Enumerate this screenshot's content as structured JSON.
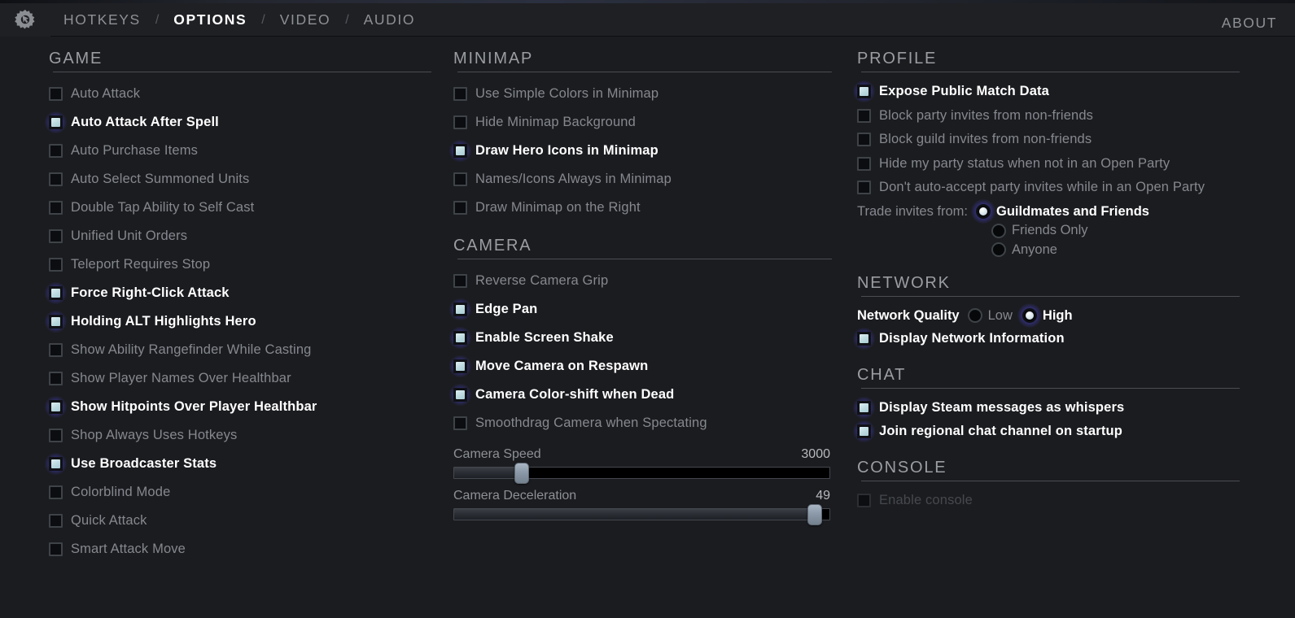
{
  "header": {
    "gear_icon": "gear-cursor-icon",
    "tabs": [
      {
        "label": "HOTKEYS",
        "active": false
      },
      {
        "label": "OPTIONS",
        "active": true
      },
      {
        "label": "VIDEO",
        "active": false
      },
      {
        "label": "AUDIO",
        "active": false
      }
    ],
    "separator": "/",
    "about_label": "ABOUT"
  },
  "game": {
    "title": "GAME",
    "items": [
      {
        "label": "Auto Attack",
        "checked": false
      },
      {
        "label": "Auto Attack After Spell",
        "checked": true
      },
      {
        "label": "Auto Purchase Items",
        "checked": false
      },
      {
        "label": "Auto Select Summoned Units",
        "checked": false
      },
      {
        "label": "Double Tap Ability to Self Cast",
        "checked": false
      },
      {
        "label": "Unified Unit Orders",
        "checked": false
      },
      {
        "label": "Teleport Requires Stop",
        "checked": false
      },
      {
        "label": "Force Right-Click Attack",
        "checked": true
      },
      {
        "label": "Holding ALT Highlights Hero",
        "checked": true
      },
      {
        "label": "Show Ability Rangefinder While Casting",
        "checked": false
      },
      {
        "label": "Show Player Names Over Healthbar",
        "checked": false
      },
      {
        "label": "Show Hitpoints Over Player Healthbar",
        "checked": true
      },
      {
        "label": "Shop Always Uses Hotkeys",
        "checked": false
      },
      {
        "label": "Use Broadcaster Stats",
        "checked": true
      },
      {
        "label": "Colorblind Mode",
        "checked": false
      },
      {
        "label": "Quick Attack",
        "checked": false
      },
      {
        "label": "Smart Attack Move",
        "checked": false
      }
    ]
  },
  "minimap": {
    "title": "MINIMAP",
    "items": [
      {
        "label": "Use Simple Colors in Minimap",
        "checked": false
      },
      {
        "label": "Hide Minimap Background",
        "checked": false
      },
      {
        "label": "Draw Hero Icons in Minimap",
        "checked": true
      },
      {
        "label": "Names/Icons Always in Minimap",
        "checked": false
      },
      {
        "label": "Draw Minimap on the Right",
        "checked": false
      }
    ]
  },
  "camera": {
    "title": "CAMERA",
    "items": [
      {
        "label": "Reverse Camera Grip",
        "checked": false
      },
      {
        "label": "Edge Pan",
        "checked": true
      },
      {
        "label": "Enable Screen Shake",
        "checked": true
      },
      {
        "label": "Move Camera on Respawn",
        "checked": true
      },
      {
        "label": "Camera Color-shift when Dead",
        "checked": true
      },
      {
        "label": "Smoothdrag Camera when Spectating",
        "checked": false
      }
    ],
    "sliders": [
      {
        "label": "Camera Speed",
        "value": "3000",
        "percent": 18
      },
      {
        "label": "Camera Deceleration",
        "value": "49",
        "percent": 96
      }
    ]
  },
  "profile": {
    "title": "PROFILE",
    "items": [
      {
        "label": "Expose Public Match Data",
        "checked": true
      },
      {
        "label": "Block party invites from non-friends",
        "checked": false
      },
      {
        "label": "Block guild invites from non-friends",
        "checked": false
      },
      {
        "label": "Hide my party status when not in an Open Party",
        "checked": false
      },
      {
        "label": "Don't auto-accept party invites while in an Open Party",
        "checked": false
      }
    ],
    "trade_label": "Trade invites from:",
    "trade_options": [
      {
        "label": "Guildmates and Friends",
        "selected": true
      },
      {
        "label": "Friends Only",
        "selected": false
      },
      {
        "label": "Anyone",
        "selected": false
      }
    ]
  },
  "network": {
    "title": "NETWORK",
    "quality_label": "Network Quality",
    "quality_options": [
      {
        "label": "Low",
        "selected": false
      },
      {
        "label": "High",
        "selected": true
      }
    ],
    "items": [
      {
        "label": "Display Network Information",
        "checked": true
      }
    ]
  },
  "chat": {
    "title": "CHAT",
    "items": [
      {
        "label": "Display Steam messages as whispers",
        "checked": true
      },
      {
        "label": "Join regional chat channel on startup",
        "checked": true
      }
    ]
  },
  "console": {
    "title": "CONSOLE",
    "items": [
      {
        "label": "Enable console",
        "checked": false,
        "disabled": true
      }
    ]
  },
  "colors": {
    "accent_glow": "#6860ee",
    "check_fill": "#c9e2e8",
    "text_active": "#ffffff",
    "text_idle": "#85888e",
    "background": "#1b1c20"
  }
}
